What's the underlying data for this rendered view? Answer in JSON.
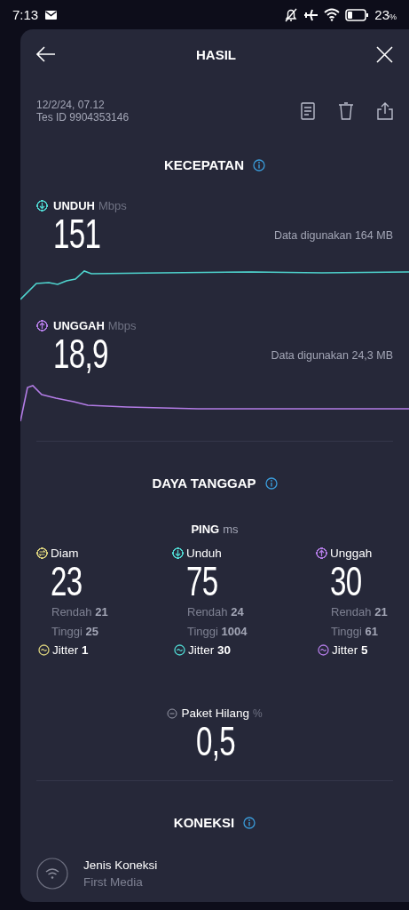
{
  "status_bar": {
    "time": "7:13",
    "battery": "23",
    "battery_unit": "%"
  },
  "header": {
    "title": "HASIL"
  },
  "meta": {
    "date": "12/2/24, 07.12",
    "test_id": "Tes ID 9904353146"
  },
  "speed": {
    "title": "KECEPATAN",
    "items": [
      {
        "kind": "download",
        "label": "UNDUH",
        "unit": "Mbps",
        "value": "151",
        "data_used": "Data digunakan 164 MB",
        "color": "#4fd6d0"
      },
      {
        "kind": "upload",
        "label": "UNGGAH",
        "unit": "Mbps",
        "value": "18,9",
        "data_used": "Data digunakan 24,3 MB",
        "color": "#b37ce6"
      }
    ]
  },
  "responsiveness": {
    "title": "DAYA TANGGAP",
    "ping_label": "PING",
    "ping_unit": "ms",
    "pings": [
      {
        "kind": "idle",
        "name": "Diam",
        "value": "23",
        "low_label": "Rendah",
        "low": "21",
        "high_label": "Tinggi",
        "high": "25",
        "jitter_label": "Jitter",
        "jitter": "1",
        "color": "#d8cf7c"
      },
      {
        "kind": "download",
        "name": "Unduh",
        "value": "75",
        "low_label": "Rendah",
        "low": "24",
        "high_label": "Tinggi",
        "high": "1004",
        "jitter_label": "Jitter",
        "jitter": "30",
        "color": "#4fd6d0"
      },
      {
        "kind": "upload",
        "name": "Unggah",
        "value": "30",
        "low_label": "Rendah",
        "low": "21",
        "high_label": "Tinggi",
        "high": "61",
        "jitter_label": "Jitter",
        "jitter": "5",
        "color": "#b37ce6"
      }
    ],
    "packet_loss": {
      "label": "Paket Hilang",
      "unit": "%",
      "value": "0,5"
    }
  },
  "connection": {
    "title": "KONEKSI",
    "items": [
      {
        "label": "Jenis Koneksi",
        "value": "First Media"
      }
    ]
  }
}
